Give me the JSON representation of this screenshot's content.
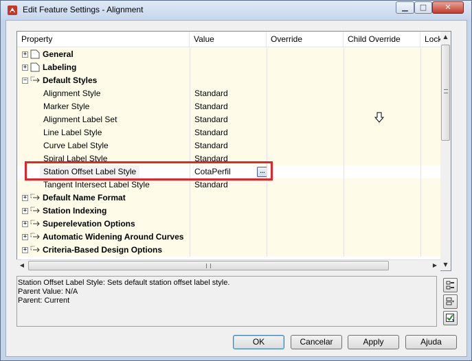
{
  "window": {
    "title": "Edit Feature Settings - Alignment",
    "minimize_glyph": "▁",
    "maximize_glyph": "□",
    "close_glyph": "✕"
  },
  "grid": {
    "columns": [
      "Property",
      "Value",
      "Override",
      "Child Override",
      "Lock"
    ],
    "rows": [
      {
        "type": "category",
        "expander": "+",
        "label": "General",
        "icon": "folder-icon"
      },
      {
        "type": "category",
        "expander": "+",
        "label": "Labeling",
        "icon": "folder-icon"
      },
      {
        "type": "category",
        "expander": "−",
        "label": "Default Styles",
        "icon": "style-icon"
      },
      {
        "type": "item",
        "label": "Alignment Style",
        "value": "Standard"
      },
      {
        "type": "item",
        "label": "Marker Style",
        "value": "Standard"
      },
      {
        "type": "item",
        "label": "Alignment Label Set",
        "value": "Standard"
      },
      {
        "type": "item",
        "label": "Line Label Style",
        "value": "Standard"
      },
      {
        "type": "item",
        "label": "Curve Label Style",
        "value": "Standard"
      },
      {
        "type": "item",
        "label": "Spiral Label Style",
        "value": "Standard"
      },
      {
        "type": "item",
        "label": "Station Offset Label Style",
        "value": "CotaPerfil",
        "selected": true,
        "ellipsis": "..."
      },
      {
        "type": "item",
        "label": "Tangent Intersect Label Style",
        "value": "Standard"
      },
      {
        "type": "category",
        "expander": "+",
        "label": "Default Name Format",
        "icon": "style-icon"
      },
      {
        "type": "category",
        "expander": "+",
        "label": "Station Indexing",
        "icon": "style-icon"
      },
      {
        "type": "category",
        "expander": "+",
        "label": "Superelevation Options",
        "icon": "style-icon"
      },
      {
        "type": "category",
        "expander": "+",
        "label": "Automatic Widening Around Curves",
        "icon": "style-icon"
      },
      {
        "type": "category",
        "expander": "+",
        "label": "Criteria-Based Design Options",
        "icon": "style-icon"
      }
    ]
  },
  "description": {
    "line1": "Station Offset Label Style: Sets default station offset label style.",
    "line2": "Parent Value: N/A",
    "line3": "Parent: Current"
  },
  "buttons": {
    "ok": "OK",
    "cancel": "Cancelar",
    "apply": "Apply",
    "help": "Ajuda"
  },
  "colors": {
    "highlight": "#e5232b",
    "row_background": "#fefce8"
  }
}
